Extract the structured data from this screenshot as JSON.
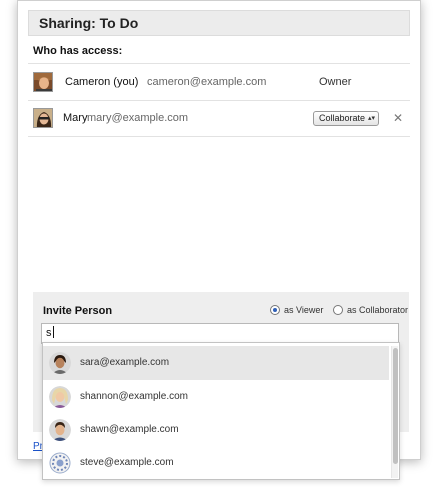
{
  "dialog": {
    "title": "Sharing: To Do",
    "access_heading": "Who has access:",
    "people": [
      {
        "name": "Cameron (you)",
        "email": "cameron@example.com",
        "role": "Owner"
      },
      {
        "name": "Mary",
        "email": "mary@example.com",
        "role": "Collaborate",
        "remove_label": "✕"
      }
    ]
  },
  "invite": {
    "title": "Invite Person",
    "options": [
      {
        "label": "as Viewer",
        "checked": true
      },
      {
        "label": "as Collaborator",
        "checked": false
      }
    ],
    "input_value": "s",
    "suggestions": [
      {
        "email": "sara@example.com"
      },
      {
        "email": "shannon@example.com"
      },
      {
        "email": "shawn@example.com"
      },
      {
        "email": "steve@example.com"
      }
    ]
  },
  "footer": {
    "link_text": "Pri"
  },
  "colors": {
    "accent": "#3060b8",
    "link": "#1a52c8",
    "panel_bg": "#eeeeee",
    "highlight": "#e7e7e7"
  }
}
